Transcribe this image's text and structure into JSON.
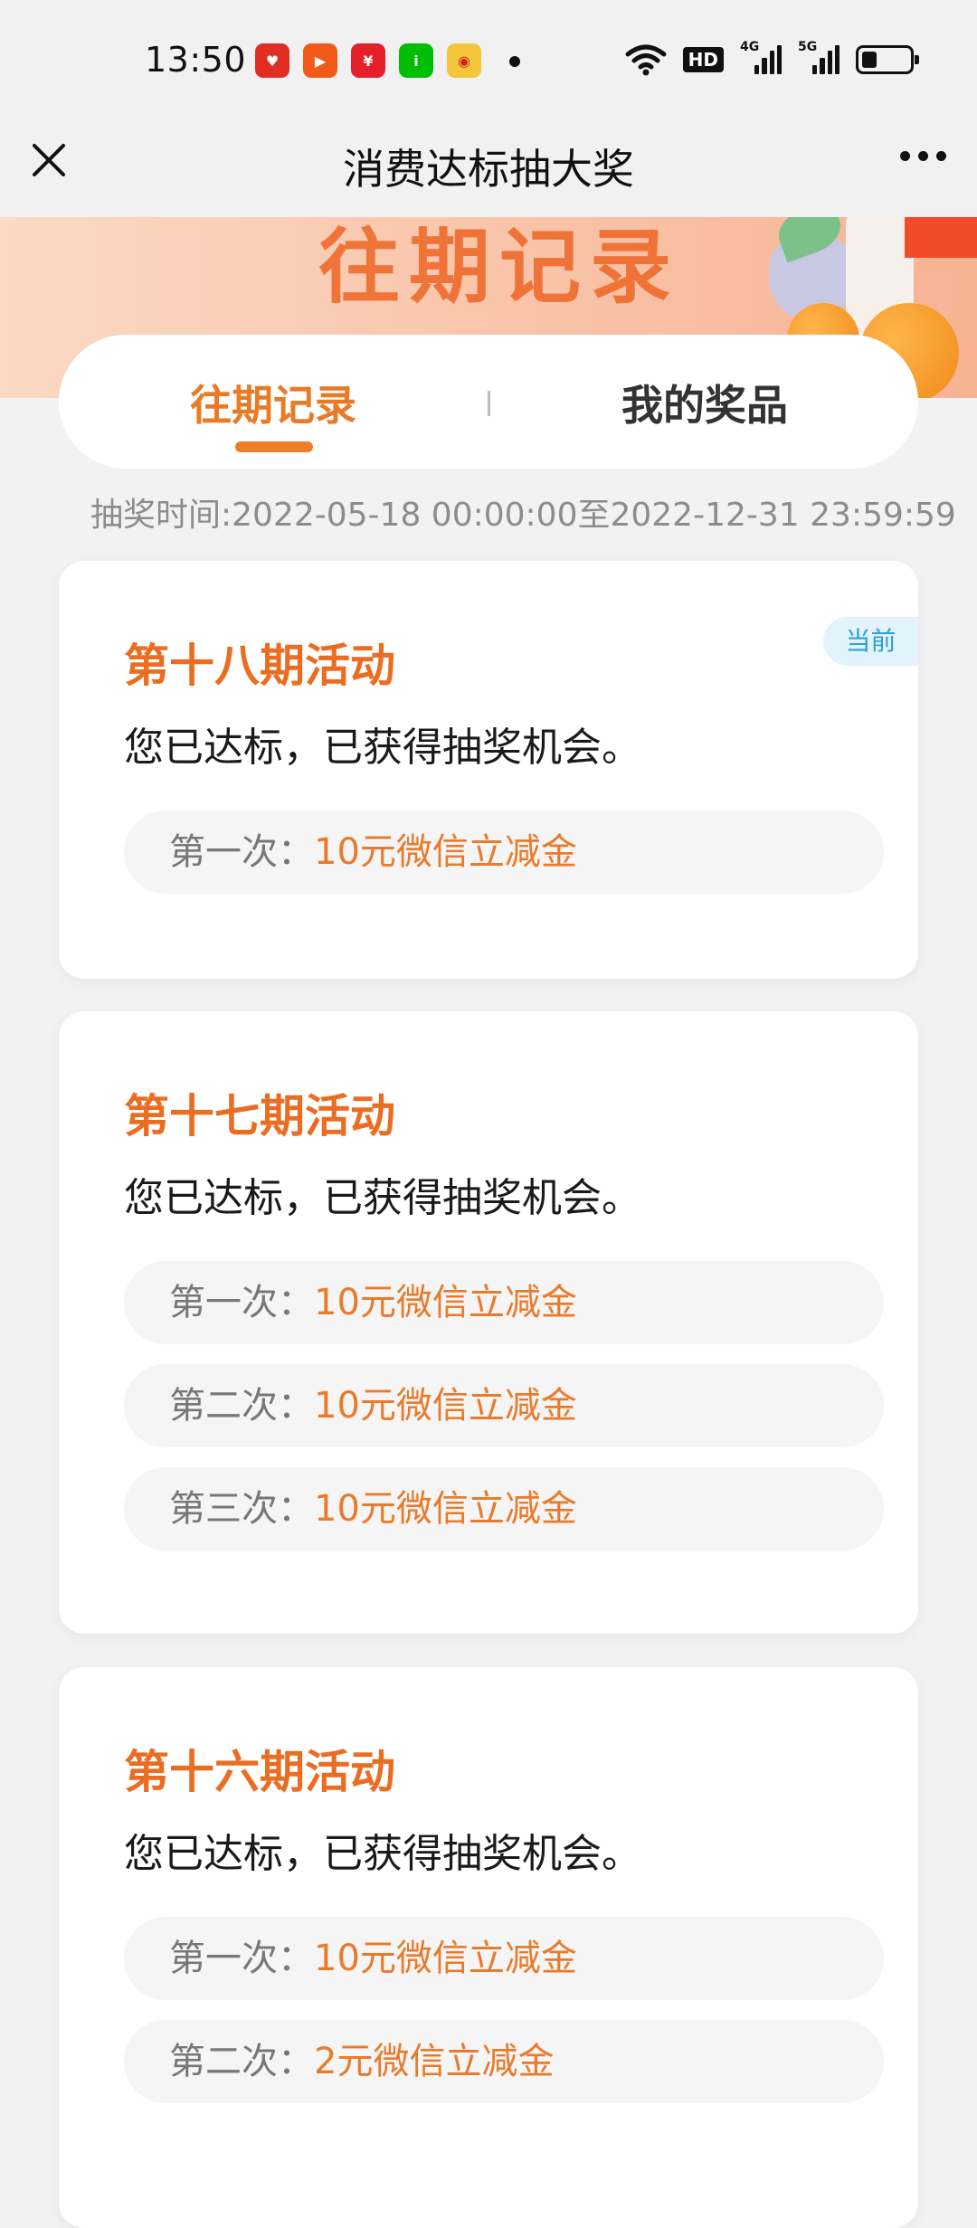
{
  "status_bar": {
    "time": "13:50",
    "apps": [
      {
        "icon": "pinduoduo-icon",
        "color": "#e02e24"
      },
      {
        "icon": "kuaishou-icon",
        "color": "#f25a1a"
      },
      {
        "icon": "yunshanfu-icon",
        "color": "#e5202b"
      },
      {
        "icon": "iqiyi-icon",
        "color": "#00be06"
      },
      {
        "icon": "weibo-icon",
        "color": "#f4c63b"
      }
    ],
    "hd_label": "HD",
    "signal_1_label": "4G",
    "signal_2_label": "5G"
  },
  "title_bar": {
    "title": "消费达标抽大奖"
  },
  "banner": {
    "title": "往期记录"
  },
  "tabs": [
    {
      "label": "往期记录",
      "active": true
    },
    {
      "label": "我的奖品",
      "active": false
    }
  ],
  "period_text": "抽奖时间:2022-05-18 00:00:00至2022-12-31 23:59:59",
  "cards": [
    {
      "title": "第十八期活动",
      "status": "您已达标，已获得抽奖机会。",
      "badge": "当前",
      "prizes": [
        {
          "label": "第一次：",
          "value": "10元微信立减金"
        }
      ]
    },
    {
      "title": "第十七期活动",
      "status": "您已达标，已获得抽奖机会。",
      "prizes": [
        {
          "label": "第一次：",
          "value": "10元微信立减金"
        },
        {
          "label": "第二次：",
          "value": "10元微信立减金"
        },
        {
          "label": "第三次：",
          "value": "10元微信立减金"
        }
      ]
    },
    {
      "title": "第十六期活动",
      "status": "您已达标，已获得抽奖机会。",
      "prizes": [
        {
          "label": "第一次：",
          "value": "10元微信立减金"
        },
        {
          "label": "第二次：",
          "value": "2元微信立减金"
        }
      ]
    }
  ],
  "colors": {
    "accent": "#ea7a25",
    "badge_text": "#2d9fd6",
    "badge_bg": "#e3f3fb"
  }
}
